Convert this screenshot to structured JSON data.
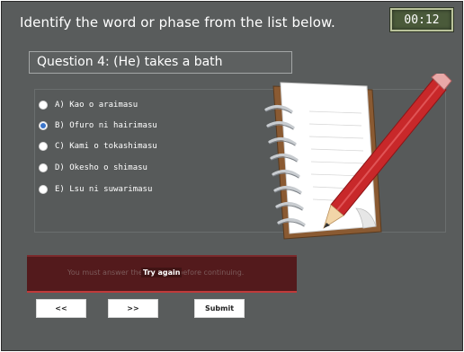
{
  "header": {
    "instruction": "Identify the word or phase from the list below.",
    "timer": "00:12"
  },
  "question": {
    "text": "Question 4: (He) takes a bath"
  },
  "options": [
    {
      "label": "A) Kao o araimasu",
      "selected": false
    },
    {
      "label": "B) Ofuro ni hairimasu",
      "selected": true
    },
    {
      "label": "C) Kami o tokashimasu",
      "selected": false
    },
    {
      "label": "D) Okesho o shimasu",
      "selected": false
    },
    {
      "label": "E) Lsu ni suwarimasu",
      "selected": false
    }
  ],
  "feedback": {
    "message": "You must answer the question before continuing.",
    "try_again": "Try again"
  },
  "controls": {
    "prev_label": "<<",
    "next_label": ">>",
    "submit_label": "Submit"
  },
  "colors": {
    "background": "#595c5c",
    "feedback_bg": "#531a1c",
    "feedback_accent": "#c03a3a",
    "radio_selected": "#3a74c9",
    "timer_bg": "#4a5a3a"
  }
}
